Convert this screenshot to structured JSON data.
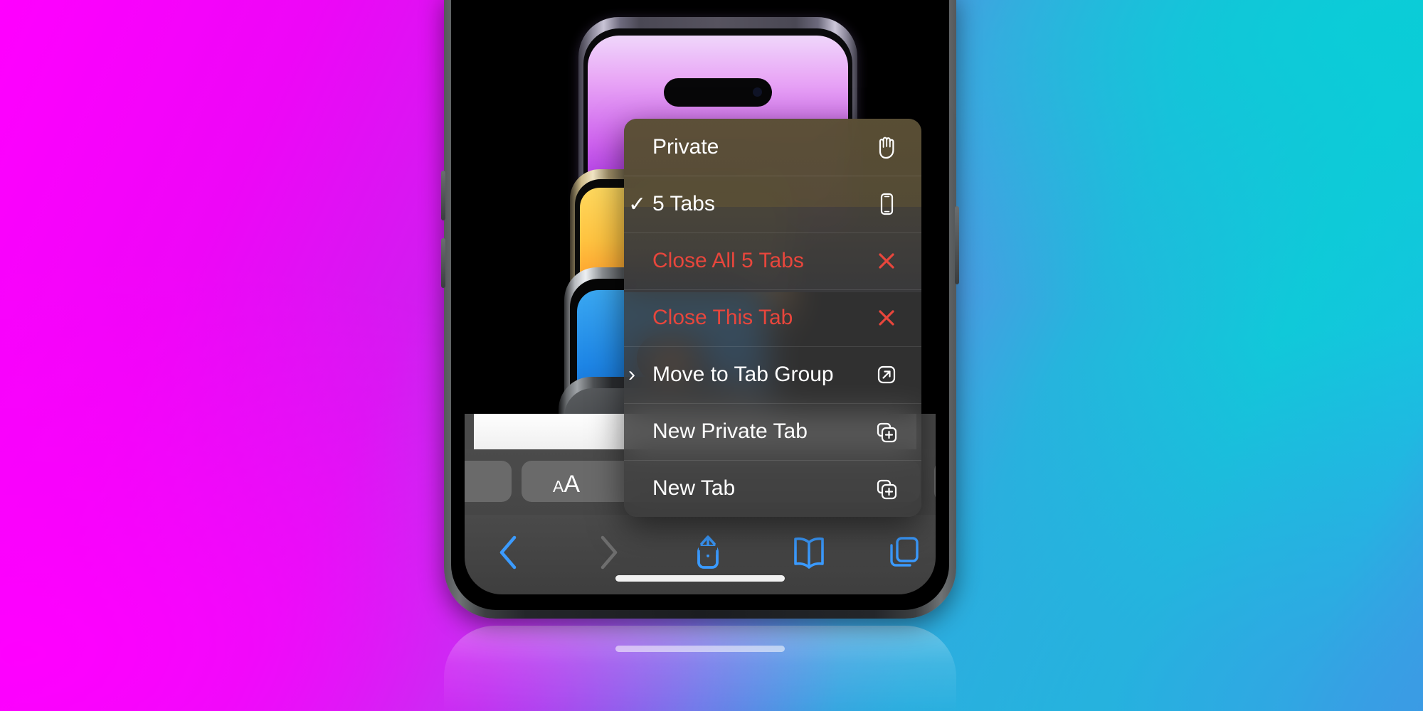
{
  "background": {
    "gradient_from": "#FF00FF",
    "gradient_mid": "#6E7BE8",
    "gradient_to": "#10C9D9",
    "corner_bottom_right": "#3B9BE4"
  },
  "device": {
    "name": "iphone-14-pro",
    "frame_color": "#1B1D20",
    "screen_background": "#000000"
  },
  "webpage": {
    "name": "apple-product-hero-image",
    "devices": [
      {
        "name": "iphone-deep-purple",
        "screen_color": "#CF63EF"
      },
      {
        "name": "iphone-gold",
        "screen_color": "#FFC441"
      },
      {
        "name": "iphone-silver",
        "screen_color": "#1E86E6"
      },
      {
        "name": "iphone-back-camera",
        "screen_color": "#35383B"
      }
    ]
  },
  "browser": {
    "name": "safari-ios",
    "address_bar": {
      "text_size_label_small": "A",
      "text_size_label_large": "A"
    },
    "toolbar": [
      {
        "name": "back",
        "icon": "chevron-left-icon",
        "enabled": true,
        "color": "#3B9BFF"
      },
      {
        "name": "forward",
        "icon": "chevron-right-icon",
        "enabled": false,
        "color": "#6E6E6E"
      },
      {
        "name": "share",
        "icon": "share-icon",
        "enabled": true,
        "color": "#3B9BFF"
      },
      {
        "name": "bookmarks",
        "icon": "book-icon",
        "enabled": true,
        "color": "#3B9BFF"
      },
      {
        "name": "tabs",
        "icon": "tabs-icon",
        "enabled": true,
        "color": "#3B9BFF"
      }
    ]
  },
  "context_menu": {
    "name": "tab-options-menu",
    "destructive_color": "#E8463C",
    "text_color": "#FFFFFF",
    "items": [
      {
        "label": "Private",
        "icon": "hand-raised-icon",
        "lead": "",
        "destructive": false
      },
      {
        "label": "5 Tabs",
        "icon": "iphone-icon",
        "lead": "✓",
        "destructive": false
      },
      {
        "label": "Close All 5 Tabs",
        "icon": "xmark-icon",
        "lead": "",
        "destructive": true
      },
      {
        "label": "Close This Tab",
        "icon": "xmark-icon",
        "lead": "",
        "destructive": true
      },
      {
        "label": "Move to Tab Group",
        "icon": "arrow-up-forward-square-icon",
        "lead": "›",
        "destructive": false
      },
      {
        "label": "New Private Tab",
        "icon": "plus-square-stack-icon",
        "lead": "",
        "destructive": false
      },
      {
        "label": "New Tab",
        "icon": "plus-square-stack-icon",
        "lead": "",
        "destructive": false
      }
    ]
  }
}
